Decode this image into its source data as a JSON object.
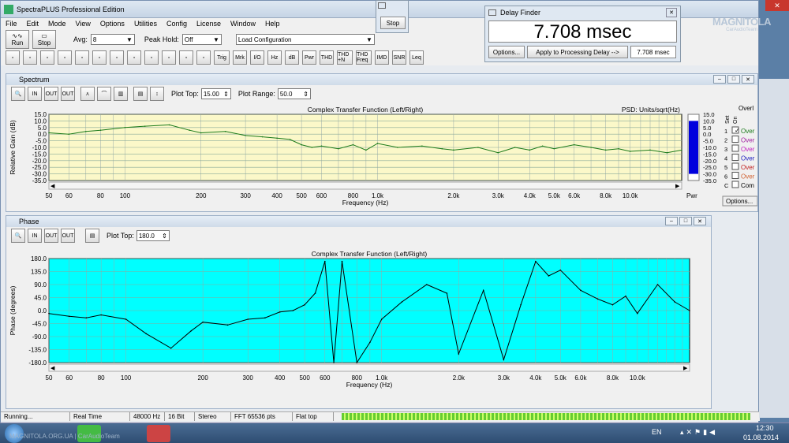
{
  "app": {
    "title": "SpectraPLUS Professional Edition"
  },
  "menu": [
    "File",
    "Edit",
    "Mode",
    "View",
    "Options",
    "Utilities",
    "Config",
    "License",
    "Window",
    "Help"
  ],
  "toolbar": {
    "run": "Run",
    "stop": "Stop",
    "avg_label": "Avg:",
    "avg_value": "8",
    "peak_label": "Peak Hold:",
    "peak_value": "Off",
    "load_config": "Load Configuration",
    "tools": [
      "Trig",
      "Mrk",
      "I/O",
      "Hz",
      "dB",
      "Pwr",
      "THD",
      "THD +N",
      "THD Freq",
      "IMD",
      "SNR",
      "Leq"
    ]
  },
  "stop_popup": {
    "label": "Stop"
  },
  "delay": {
    "title": "Delay Finder",
    "value": "7.708 msec",
    "options": "Options...",
    "apply": "Apply to Processing Delay -->",
    "field": "7.708 msec"
  },
  "spectrum": {
    "title": "Spectrum",
    "plot_top_label": "Plot Top:",
    "plot_top": "15.00",
    "plot_range_label": "Plot Range:",
    "plot_range": "50.0",
    "chart_title": "Complex Transfer Function (Left/Right)",
    "psd": "PSD: Units/sqrt(Hz)",
    "ylabel": "Relative Gain (dB)",
    "xlabel": "Frequency (Hz)",
    "overlays_label": "Overl",
    "set_label": "Set",
    "on_label": "On",
    "overlay_items": [
      "Over",
      "Over",
      "Over",
      "Over",
      "Over",
      "Over",
      "Com"
    ],
    "options_btn": "Options...",
    "pwr": "Pwr"
  },
  "phase": {
    "title": "Phase",
    "plot_top_label": "Plot Top:",
    "plot_top": "180.0",
    "chart_title": "Complex Transfer Function (Left/Right)",
    "ylabel": "Phase (degrees)",
    "xlabel": "Frequency (Hz)"
  },
  "chart_data": [
    {
      "type": "line",
      "title": "Complex Transfer Function (Left/Right)",
      "ylabel": "Relative Gain (dB)",
      "xlabel": "Frequency (Hz)",
      "xscale": "log",
      "xlim": [
        50,
        16000
      ],
      "ylim": [
        -35,
        15
      ],
      "yticks": [
        "15.0",
        "10.0",
        "5.0",
        "0.0",
        "-5.0",
        "-10.0",
        "-15.0",
        "-20.0",
        "-25.0",
        "-30.0",
        "-35.0"
      ],
      "xticks": [
        "50",
        "60",
        "80",
        "100",
        "200",
        "300",
        "400",
        "500",
        "600",
        "800",
        "1.0k",
        "2.0k",
        "3.0k",
        "4.0k",
        "5.0k",
        "6.0k",
        "8.0k",
        "10.0k"
      ],
      "grid": true,
      "x": [
        50,
        60,
        70,
        80,
        100,
        120,
        150,
        180,
        200,
        250,
        300,
        350,
        400,
        450,
        500,
        550,
        600,
        700,
        800,
        900,
        1000,
        1200,
        1500,
        1800,
        2000,
        2500,
        3000,
        3500,
        4000,
        4500,
        5000,
        6000,
        7000,
        8000,
        9000,
        10000,
        12000,
        14000,
        16000
      ],
      "y": [
        1,
        0,
        2,
        3,
        5,
        6,
        7,
        3,
        1,
        2,
        -1,
        -2,
        -3,
        -4,
        -8,
        -10,
        -9,
        -11,
        -8,
        -12,
        -7,
        -10,
        -9,
        -11,
        -12,
        -10,
        -14,
        -10,
        -12,
        -9,
        -11,
        -8,
        -10,
        -12,
        -11,
        -13,
        -12,
        -14,
        -12
      ]
    },
    {
      "type": "line",
      "title": "Complex Transfer Function (Left/Right)",
      "ylabel": "Phase (degrees)",
      "xlabel": "Frequency (Hz)",
      "xscale": "log",
      "xlim": [
        50,
        16000
      ],
      "ylim": [
        -180,
        180
      ],
      "yticks": [
        "180.0",
        "135.0",
        "90.0",
        "45.0",
        "0.0",
        "-45.0",
        "-90.0",
        "-135.0",
        "-180.0"
      ],
      "xticks": [
        "50",
        "60",
        "80",
        "100",
        "200",
        "300",
        "400",
        "500",
        "600",
        "800",
        "1.0k",
        "2.0k",
        "3.0k",
        "4.0k",
        "5.0k",
        "6.0k",
        "8.0k",
        "10.0k"
      ],
      "grid": true,
      "x": [
        50,
        60,
        70,
        80,
        100,
        120,
        150,
        180,
        200,
        250,
        300,
        350,
        400,
        450,
        500,
        550,
        600,
        650,
        700,
        800,
        900,
        1000,
        1200,
        1500,
        1800,
        2000,
        2500,
        3000,
        3500,
        4000,
        4500,
        5000,
        6000,
        7000,
        8000,
        9000,
        10000,
        12000,
        14000,
        16000
      ],
      "y": [
        -10,
        -20,
        -25,
        -15,
        -30,
        -80,
        -130,
        -70,
        -40,
        -50,
        -30,
        -25,
        -5,
        0,
        20,
        60,
        170,
        -180,
        170,
        -180,
        -110,
        -30,
        30,
        90,
        60,
        -150,
        70,
        -170,
        20,
        170,
        120,
        140,
        70,
        40,
        20,
        50,
        -10,
        90,
        30,
        0
      ]
    }
  ],
  "status": [
    "Running...",
    "Real Time",
    "48000 Hz",
    "16 Bit",
    "Stereo",
    "FFT 65536 pts",
    "Flat top"
  ],
  "taskbar": {
    "lang": "EN",
    "time": "12:30",
    "date": "01.08.2014"
  },
  "watermark": {
    "logo": "MAGNITOLA",
    "sub": "CarAudioTeam",
    "footer": "MAGNITOLA.ORG.UA | CarAudioTeam"
  },
  "colors": {
    "spectrum_bg": "#fbf8c9",
    "phase_bg": "#00ffff",
    "spectrum_line": "#1a7a1a",
    "phase_line": "#000000",
    "level": "#0000dd"
  }
}
